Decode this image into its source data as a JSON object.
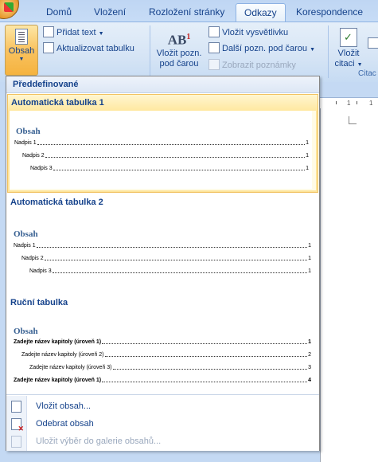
{
  "ribbon_tabs": [
    "Domů",
    "Vložení",
    "Rozložení stránky",
    "Odkazy",
    "Korespondence"
  ],
  "active_tab": "Odkazy",
  "ribbon": {
    "toc_button": "Obsah",
    "add_text": "Přidat text",
    "update_table": "Aktualizovat tabulku",
    "insert_footnote_line1": "Vložit pozn.",
    "insert_footnote_line2": "pod čarou",
    "insert_endnote": "Vložit vysvětlivku",
    "next_footnote": "Další pozn. pod čarou",
    "show_notes": "Zobrazit poznámky",
    "insert_citation_line1": "Vložit",
    "insert_citation_line2": "citaci",
    "citations_group_partial": "Citac"
  },
  "ruler": {
    "marks": [
      "1",
      "1"
    ]
  },
  "gallery": {
    "header": "Předdefinované",
    "items": [
      {
        "title": "Automatická tabulka 1",
        "heading": "Obsah",
        "lines": [
          {
            "text": "Nadpis 1",
            "page": "1",
            "level": 1
          },
          {
            "text": "Nadpis 2",
            "page": "1",
            "level": 2
          },
          {
            "text": "Nadpis 3",
            "page": "1",
            "level": 3
          }
        ]
      },
      {
        "title": "Automatická tabulka 2",
        "heading": "Obsah",
        "lines": [
          {
            "text": "Nadpis 1",
            "page": "1",
            "level": 1
          },
          {
            "text": "Nadpis 2",
            "page": "1",
            "level": 2
          },
          {
            "text": "Nadpis 3",
            "page": "1",
            "level": 3
          }
        ]
      },
      {
        "title": "Ruční tabulka",
        "heading": "Obsah",
        "lines": [
          {
            "text": "Zadejte název kapitoly (úroveň 1)",
            "page": "1",
            "level": 1
          },
          {
            "text": "Zadejte název kapitoly (úroveň 2)",
            "page": "2",
            "level": 2
          },
          {
            "text": "Zadejte název kapitoly (úroveň 3)",
            "page": "3",
            "level": 3
          },
          {
            "text": "Zadejte název kapitoly (úroveň 1)",
            "page": "4",
            "level": 1
          }
        ]
      }
    ]
  },
  "menu": {
    "insert_toc": "Vložit obsah...",
    "remove_toc": "Odebrat obsah",
    "save_selection": "Uložit výběr do galerie obsahů..."
  }
}
